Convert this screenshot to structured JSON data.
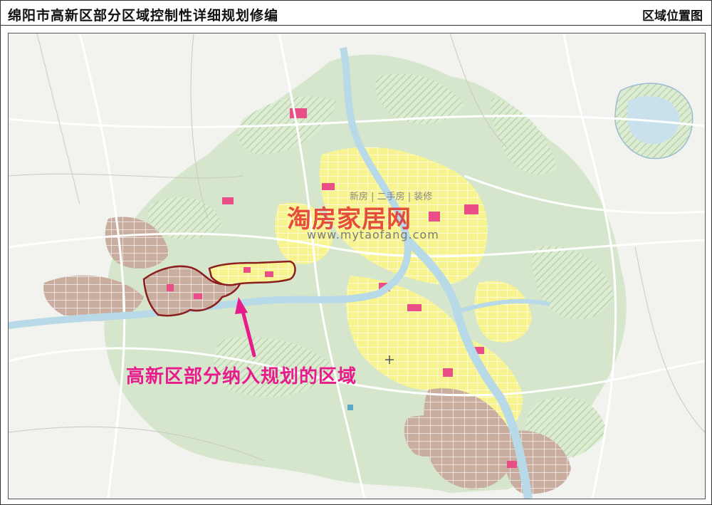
{
  "header": {
    "title": "绵阳市高新区部分区域控制性详细规划修编",
    "right_label": "区域位置图"
  },
  "annotation": {
    "text": "高新区部分纳入规划的区域",
    "color": "#e81b8c"
  },
  "watermark": {
    "brand": "淘房家居网",
    "tagline": "新房 | 二手房 | 装修",
    "url": "www.mytaofang.com"
  },
  "map_colors": {
    "background": "#f2f2ef",
    "green_zone": "#cfe3c3",
    "hatch": "#b9d7ad",
    "river": "#b7d9e8",
    "residential": "#f7f48f",
    "commercial": "#e94f86",
    "brown_zone": "#c9aea0",
    "road": "#ffffff",
    "highlight_outline": "#8b1e1e"
  }
}
